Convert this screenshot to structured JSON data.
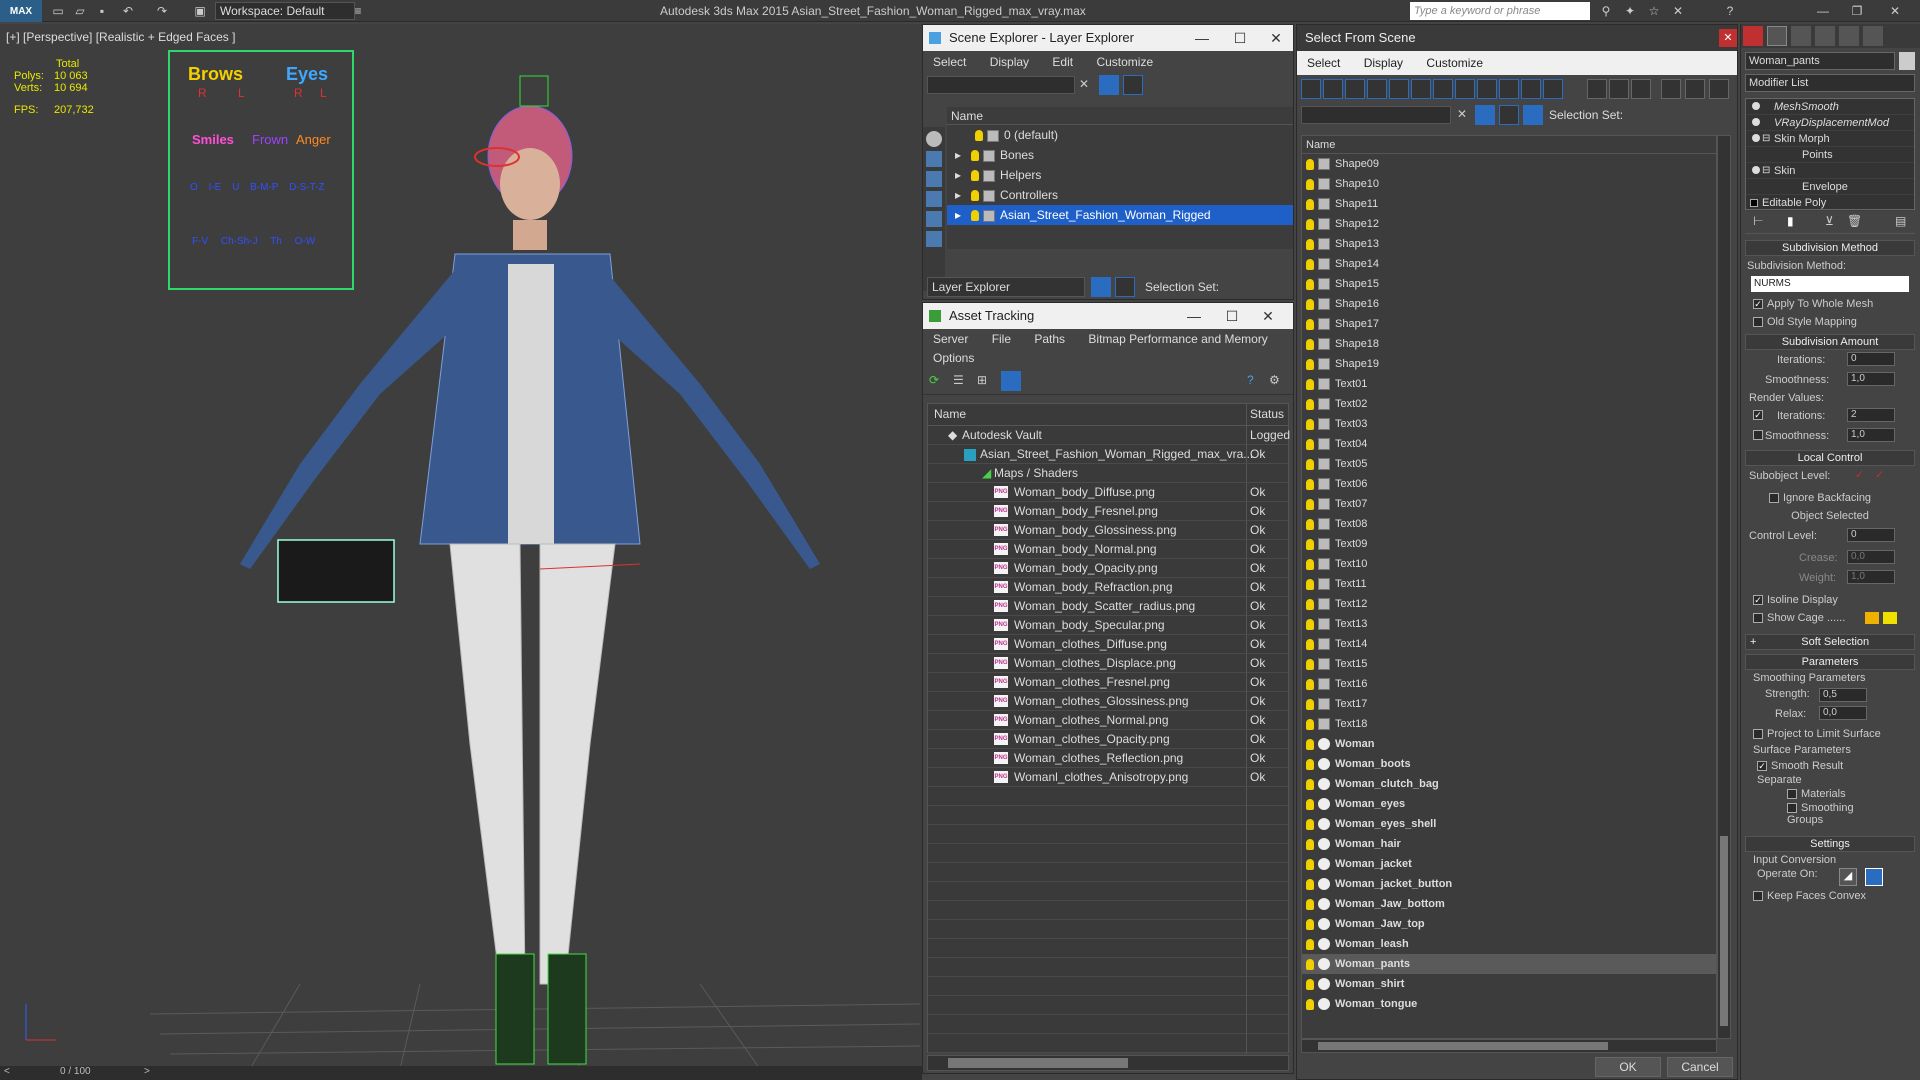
{
  "titlebar": {
    "logo": "MAX",
    "workspace": "Workspace: Default",
    "app_title": "Autodesk 3ds Max  2015     Asian_Street_Fashion_Woman_Rigged_max_vray.max",
    "search_placeholder": "Type a keyword or phrase"
  },
  "viewport": {
    "label": "[+] [Perspective] [Realistic + Edged Faces ]",
    "stats": {
      "total": "Total",
      "polys_label": "Polys:",
      "polys": "10 063",
      "verts_label": "Verts:",
      "verts": "10 694",
      "fps_label": "FPS:",
      "fps": "207,732"
    },
    "face_ui": {
      "brows": "Brows",
      "eyes": "Eyes",
      "r": "R",
      "l": "L",
      "smiles": "Smiles",
      "frown": "Frown",
      "anger": "Anger",
      "visemes1": [
        "O",
        "I-E",
        "U",
        "B-M-P",
        "D-S-T-Z"
      ],
      "visemes2": [
        "F-V",
        "Ch-Sh-J",
        "Th",
        "O-W"
      ]
    },
    "timeline": "0 / 100"
  },
  "scene_explorer": {
    "title": "Scene Explorer - Layer Explorer",
    "menu": [
      "Select",
      "Display",
      "Edit",
      "Customize"
    ],
    "column": "Name",
    "layers": [
      {
        "label": "0 (default)",
        "selected": false
      },
      {
        "label": "Bones",
        "selected": false
      },
      {
        "label": "Helpers",
        "selected": false
      },
      {
        "label": "Controllers",
        "selected": false
      },
      {
        "label": "Asian_Street_Fashion_Woman_Rigged",
        "selected": true
      }
    ],
    "footer_dropdown": "Layer Explorer",
    "selection_set": "Selection Set:"
  },
  "asset_tracking": {
    "title": "Asset Tracking",
    "menu": [
      "Server",
      "File",
      "Paths",
      "Bitmap Performance and Memory"
    ],
    "menu2": "Options",
    "col_name": "Name",
    "col_status": "Status",
    "vault": {
      "name": "Autodesk Vault",
      "status": "Logged"
    },
    "file": {
      "name": "Asian_Street_Fashion_Woman_Rigged_max_vra...",
      "status": "Ok"
    },
    "maps": "Maps / Shaders",
    "png_badge": "PNG",
    "assets": [
      {
        "name": "Woman_body_Diffuse.png",
        "status": "Ok"
      },
      {
        "name": "Woman_body_Fresnel.png",
        "status": "Ok"
      },
      {
        "name": "Woman_body_Glossiness.png",
        "status": "Ok"
      },
      {
        "name": "Woman_body_Normal.png",
        "status": "Ok"
      },
      {
        "name": "Woman_body_Opacity.png",
        "status": "Ok"
      },
      {
        "name": "Woman_body_Refraction.png",
        "status": "Ok"
      },
      {
        "name": "Woman_body_Scatter_radius.png",
        "status": "Ok"
      },
      {
        "name": "Woman_body_Specular.png",
        "status": "Ok"
      },
      {
        "name": "Woman_clothes_Diffuse.png",
        "status": "Ok"
      },
      {
        "name": "Woman_clothes_Displace.png",
        "status": "Ok"
      },
      {
        "name": "Woman_clothes_Fresnel.png",
        "status": "Ok"
      },
      {
        "name": "Woman_clothes_Glossiness.png",
        "status": "Ok"
      },
      {
        "name": "Woman_clothes_Normal.png",
        "status": "Ok"
      },
      {
        "name": "Woman_clothes_Opacity.png",
        "status": "Ok"
      },
      {
        "name": "Woman_clothes_Reflection.png",
        "status": "Ok"
      },
      {
        "name": "Womanl_clothes_Anisotropy.png",
        "status": "Ok"
      }
    ]
  },
  "select_from_scene": {
    "title": "Select From Scene",
    "menu": [
      "Select",
      "Display",
      "Customize"
    ],
    "selection_set": "Selection Set:",
    "column": "Name",
    "items": [
      {
        "label": "Shape09",
        "kind": "shape"
      },
      {
        "label": "Shape10",
        "kind": "shape"
      },
      {
        "label": "Shape11",
        "kind": "shape"
      },
      {
        "label": "Shape12",
        "kind": "shape"
      },
      {
        "label": "Shape13",
        "kind": "shape"
      },
      {
        "label": "Shape14",
        "kind": "shape"
      },
      {
        "label": "Shape15",
        "kind": "shape"
      },
      {
        "label": "Shape16",
        "kind": "shape"
      },
      {
        "label": "Shape17",
        "kind": "shape"
      },
      {
        "label": "Shape18",
        "kind": "shape"
      },
      {
        "label": "Shape19",
        "kind": "shape"
      },
      {
        "label": "Text01",
        "kind": "shape"
      },
      {
        "label": "Text02",
        "kind": "shape"
      },
      {
        "label": "Text03",
        "kind": "shape"
      },
      {
        "label": "Text04",
        "kind": "shape"
      },
      {
        "label": "Text05",
        "kind": "shape"
      },
      {
        "label": "Text06",
        "kind": "shape"
      },
      {
        "label": "Text07",
        "kind": "shape"
      },
      {
        "label": "Text08",
        "kind": "shape"
      },
      {
        "label": "Text09",
        "kind": "shape"
      },
      {
        "label": "Text10",
        "kind": "shape"
      },
      {
        "label": "Text11",
        "kind": "shape"
      },
      {
        "label": "Text12",
        "kind": "shape"
      },
      {
        "label": "Text13",
        "kind": "shape"
      },
      {
        "label": "Text14",
        "kind": "shape"
      },
      {
        "label": "Text15",
        "kind": "shape"
      },
      {
        "label": "Text16",
        "kind": "shape"
      },
      {
        "label": "Text17",
        "kind": "shape"
      },
      {
        "label": "Text18",
        "kind": "shape"
      },
      {
        "label": "Woman",
        "kind": "mesh"
      },
      {
        "label": "Woman_boots",
        "kind": "mesh"
      },
      {
        "label": "Woman_clutch_bag",
        "kind": "mesh"
      },
      {
        "label": "Woman_eyes",
        "kind": "mesh"
      },
      {
        "label": "Woman_eyes_shell",
        "kind": "mesh"
      },
      {
        "label": "Woman_hair",
        "kind": "mesh"
      },
      {
        "label": "Woman_jacket",
        "kind": "mesh"
      },
      {
        "label": "Woman_jacket_button",
        "kind": "mesh"
      },
      {
        "label": "Woman_Jaw_bottom",
        "kind": "mesh"
      },
      {
        "label": "Woman_Jaw_top",
        "kind": "mesh"
      },
      {
        "label": "Woman_leash",
        "kind": "mesh"
      },
      {
        "label": "Woman_pants",
        "kind": "mesh",
        "highlighted": true
      },
      {
        "label": "Woman_shirt",
        "kind": "mesh"
      },
      {
        "label": "Woman_tongue",
        "kind": "mesh"
      }
    ],
    "ok": "OK",
    "cancel": "Cancel"
  },
  "command_panel": {
    "object_name": "Woman_pants",
    "modifier_list": "Modifier List",
    "stack": [
      {
        "label": "MeshSmooth",
        "italic": true
      },
      {
        "label": "VRayDisplacementMod",
        "italic": true
      },
      {
        "label": "Skin Morph",
        "italic": false
      },
      {
        "label": "Points",
        "italic": false
      },
      {
        "label": "Skin",
        "italic": false
      },
      {
        "label": "Envelope",
        "italic": false
      },
      {
        "label": "Editable Poly",
        "italic": false
      }
    ],
    "subdivision_method_header": "Subdivision Method",
    "subdivision_method_label": "Subdivision Method:",
    "subdivision_method": "NURMS",
    "apply_whole_mesh": "Apply To Whole Mesh",
    "old_style_mapping": "Old Style Mapping",
    "subdivision_amount_header": "Subdivision Amount",
    "iterations_label": "Iterations:",
    "iterations": "0",
    "smoothness_label": "Smoothness:",
    "smoothness": "1,0",
    "render_values": "Render Values:",
    "render_iterations": "2",
    "render_smoothness": "1,0",
    "local_control_header": "Local Control",
    "subobject_level": "Subobject Level:",
    "ignore_backfacing": "Ignore Backfacing",
    "object_selected": "Object Selected",
    "control_level_label": "Control Level:",
    "control_level": "0",
    "crease_label": "Crease:",
    "crease": "0,0",
    "weight_label": "Weight:",
    "weight": "1,0",
    "isoline_display": "Isoline Display",
    "show_cage": "Show Cage ......",
    "soft_selection_header": "Soft Selection",
    "parameters_header": "Parameters",
    "smoothing_parameters": "Smoothing Parameters",
    "strength_label": "Strength:",
    "strength": "0,5",
    "relax_label": "Relax:",
    "relax": "0,0",
    "project_limit": "Project to Limit Surface",
    "surface_parameters": "Surface Parameters",
    "smooth_result": "Smooth Result",
    "separate": "Separate",
    "materials": "Materials",
    "smoothing_groups": "Smoothing Groups",
    "settings_header": "Settings",
    "input_conversion": "Input Conversion",
    "operate_on": "Operate On:",
    "keep_faces_convex": "Keep Faces Convex"
  }
}
